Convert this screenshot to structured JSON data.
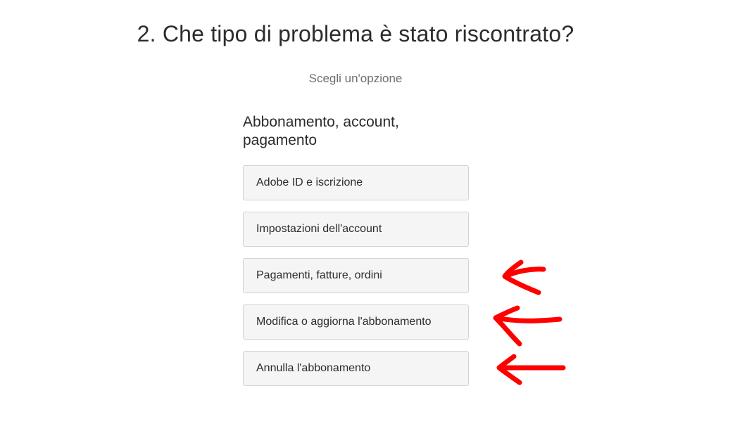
{
  "question": {
    "title": "2. Che tipo di problema è stato riscontrato?",
    "subtitle": "Scegli un'opzione"
  },
  "category": {
    "heading": "Abbonamento, account, pagamento",
    "options": [
      {
        "label": "Adobe ID e iscrizione"
      },
      {
        "label": "Impostazioni dell'account"
      },
      {
        "label": "Pagamenti, fatture, ordini"
      },
      {
        "label": "Modifica o aggiorna l'abbonamento"
      },
      {
        "label": "Annulla l'abbonamento"
      }
    ]
  },
  "annotations": {
    "arrow_color": "#ff0000",
    "arrow_targets": [
      "Pagamenti, fatture, ordini",
      "Modifica o aggiorna l'abbonamento",
      "Annulla l'abbonamento"
    ]
  }
}
